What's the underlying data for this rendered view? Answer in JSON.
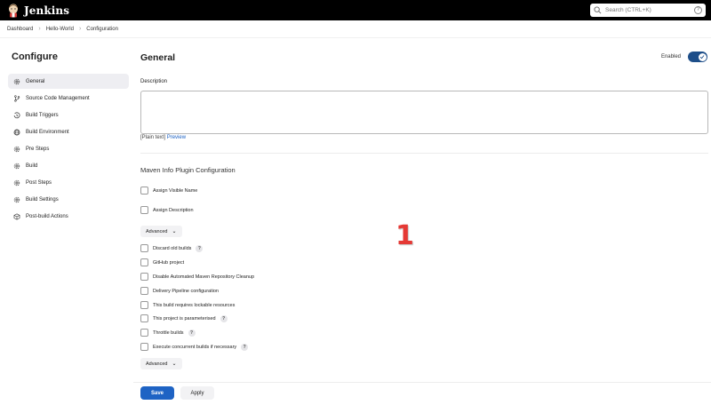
{
  "header": {
    "brand": "Jenkins",
    "search_placeholder": "Search (CTRL+K)",
    "help_glyph": "?"
  },
  "breadcrumb": [
    "Dashboard",
    "Hello-World",
    "Configuration"
  ],
  "sidebar": {
    "title": "Configure",
    "items": [
      {
        "label": "General",
        "icon": "gear-icon",
        "active": true
      },
      {
        "label": "Source Code Management",
        "icon": "branch-icon"
      },
      {
        "label": "Build Triggers",
        "icon": "clock-icon"
      },
      {
        "label": "Build Environment",
        "icon": "globe-icon"
      },
      {
        "label": "Pre Steps",
        "icon": "gear-icon"
      },
      {
        "label": "Build",
        "icon": "gear-icon"
      },
      {
        "label": "Post Steps",
        "icon": "gear-icon"
      },
      {
        "label": "Build Settings",
        "icon": "gear-icon"
      },
      {
        "label": "Post-build Actions",
        "icon": "cube-icon"
      }
    ]
  },
  "main": {
    "title": "General",
    "enabled_label": "Enabled",
    "enabled": true,
    "description_label": "Description",
    "description_value": "",
    "plain_text": "[Plain text]",
    "preview": "Preview",
    "maven_section_title": "Maven Info Plugin Configuration",
    "maven_options": [
      "Assign Visible Name",
      "Assign Description"
    ],
    "advanced_label": "Advanced",
    "options": [
      {
        "label": "Discard old builds",
        "help": true
      },
      {
        "label": "GitHub project",
        "help": false
      },
      {
        "label": "Disable Automated Maven Repository Cleanup",
        "help": false
      },
      {
        "label": "Delivery Pipeline configuration",
        "help": false
      },
      {
        "label": "This build requires lockable resources",
        "help": false
      },
      {
        "label": "This project is parameterised",
        "help": true
      },
      {
        "label": "Throttle builds",
        "help": true
      },
      {
        "label": "Execute concurrent builds if necessary",
        "help": true
      }
    ],
    "help_glyph": "?",
    "annotation": "1"
  },
  "footer": {
    "save_label": "Save",
    "apply_label": "Apply"
  },
  "colors": {
    "accent": "#1e63c4",
    "toggle": "#1d4e89",
    "annotation": "#e53935"
  }
}
